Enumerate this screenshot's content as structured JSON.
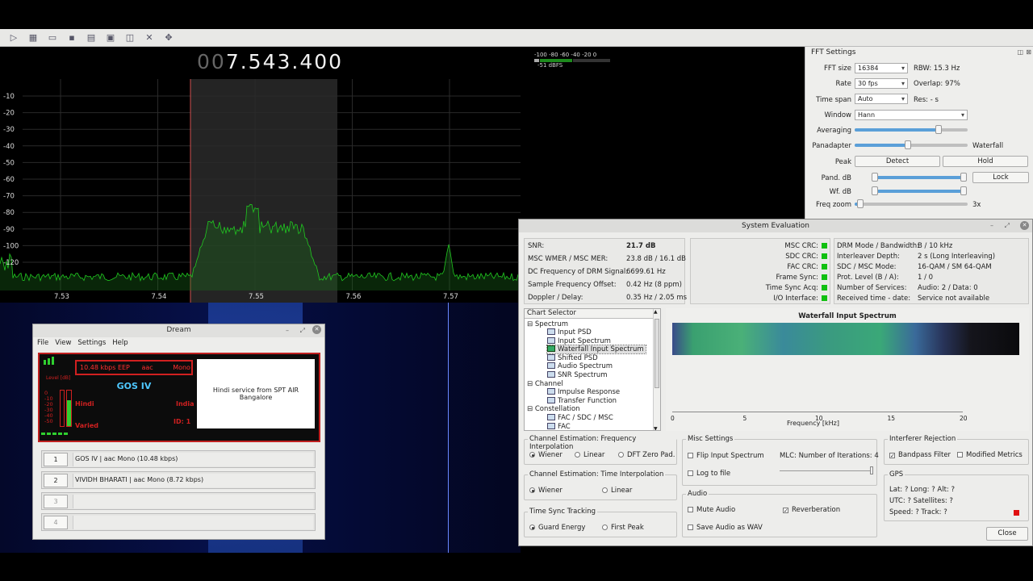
{
  "frequency": {
    "dim_digits": "00",
    "digits": "7.543.400"
  },
  "meter": {
    "scale": "-100 -80 -60 -40 -20 0",
    "level": "-51 dBFS"
  },
  "spectrum": {
    "y_ticks": [
      "-10",
      "-20",
      "-30",
      "-40",
      "-50",
      "-60",
      "-70",
      "-80",
      "-90",
      "-100",
      "-120"
    ],
    "x_ticks": [
      "7.53",
      "7.54",
      "7.55",
      "7.56",
      "7.57"
    ]
  },
  "fft": {
    "title": "FFT Settings",
    "fft_size_label": "FFT size",
    "fft_size": "16384",
    "rbw": "RBW: 15.3 Hz",
    "rate_label": "Rate",
    "rate": "30 fps",
    "overlap": "Overlap: 97%",
    "timespan_label": "Time span",
    "timespan": "Auto",
    "res": "Res: - s",
    "window_label": "Window",
    "window": "Hann",
    "averaging_label": "Averaging",
    "panadapter_label": "Panadapter",
    "waterfall_label": "Waterfall",
    "peak_label": "Peak",
    "detect": "Detect",
    "hold": "Hold",
    "pand_db_label": "Pand. dB",
    "lock": "Lock",
    "wf_db_label": "Wf. dB",
    "freq_zoom_label": "Freq zoom",
    "freq_zoom": "3x",
    "averaging_level": 0.74,
    "panadapter_level": 0.47,
    "freq_zoom_level": 0.05
  },
  "dream": {
    "title": "Dream",
    "menu": [
      "File",
      "View",
      "Settings",
      "Help"
    ],
    "level_label": "Level [dB]",
    "level_scale": [
      "0",
      "-10",
      "-20",
      "-30",
      "-40",
      "-50"
    ],
    "bitrate": "10.48 kbps EEP",
    "codec": "aac",
    "mode": "Mono",
    "station": "GOS IV",
    "language": "Hindi",
    "country": "India",
    "genre": "Varied",
    "id": "ID:  1",
    "text_message": "Hindi service from SPT AIR Bangalore",
    "services": [
      {
        "num": "1",
        "text": "GOS IV  |   aac Mono (10.48 kbps)"
      },
      {
        "num": "2",
        "text": "VIVIDH BHARATI  |   aac Mono (8.72 kbps)"
      },
      {
        "num": "3",
        "text": ""
      },
      {
        "num": "4",
        "text": ""
      }
    ]
  },
  "sysev": {
    "title": "System Evaluation",
    "params": [
      {
        "k": "SNR:",
        "v": "21.7 dB"
      },
      {
        "k": "MSC WMER / MSC MER:",
        "v": "23.8 dB / 16.1 dB"
      },
      {
        "k": "DC Frequency of DRM Signal:",
        "v": "6699.61 Hz"
      },
      {
        "k": "Sample Frequency Offset:",
        "v": "0.42 Hz (8 ppm)"
      },
      {
        "k": "Doppler / Delay:",
        "v": "0.35 Hz / 2.05 ms"
      }
    ],
    "crc": [
      "MSC CRC:",
      "SDC CRC:",
      "FAC CRC:",
      "Frame Sync:",
      "Time Sync Acq:",
      "I/O Interface:"
    ],
    "modes": [
      {
        "k": "DRM Mode / Bandwidth:",
        "v": "B / 10 kHz"
      },
      {
        "k": "Interleaver Depth:",
        "v": "2 s (Long Interleaving)"
      },
      {
        "k": "SDC / MSC Mode:",
        "v": "16-QAM / SM 64-QAM"
      },
      {
        "k": "Prot. Level (B / A):",
        "v": "1 / 0"
      },
      {
        "k": "Number of Services:",
        "v": "Audio: 2 / Data: 0"
      },
      {
        "k": "Received time - date:",
        "v": "Service not available"
      }
    ],
    "chart_selector": "Chart Selector",
    "tree": {
      "spectrum": "Spectrum",
      "spectrum_items": [
        "Input PSD",
        "Input Spectrum",
        "Waterfall Input Spectrum",
        "Shifted PSD",
        "Audio Spectrum",
        "SNR Spectrum"
      ],
      "channel": "Channel",
      "channel_items": [
        "Impulse Response",
        "Transfer Function"
      ],
      "constellation": "Constellation",
      "constellation_items": [
        "FAC / SDC / MSC",
        "FAC"
      ]
    },
    "chart_title": "Waterfall Input Spectrum",
    "chart_x_ticks": [
      "0",
      "5",
      "10",
      "15",
      "20"
    ],
    "chart_xlabel": "Frequency [kHz]",
    "fi_title": "Channel Estimation: Frequency Interpolation",
    "fi_opts": [
      "Wiener",
      "Linear",
      "DFT Zero Pad."
    ],
    "ti_title": "Channel Estimation: Time Interpolation",
    "ti_opts": [
      "Wiener",
      "Linear"
    ],
    "ts_title": "Time Sync Tracking",
    "ts_opts": [
      "Guard Energy",
      "First Peak"
    ],
    "misc_title": "Misc Settings",
    "flip": "Flip Input Spectrum",
    "mlc": "MLC: Number of Iterations: 4",
    "log": "Log to file",
    "audio_title": "Audio",
    "mute": "Mute Audio",
    "reverb": "Reverberation",
    "save_wav": "Save Audio as WAV",
    "ir_title": "Interferer Rejection",
    "bandpass": "Bandpass Filter",
    "modified": "Modified Metrics",
    "gps_title": "GPS",
    "gps1": "Lat: ?  Long: ?  Alt: ?",
    "gps2": "UTC: ?  Satellites: ?",
    "gps3": "Speed: ?  Track: ?",
    "close": "Close"
  }
}
